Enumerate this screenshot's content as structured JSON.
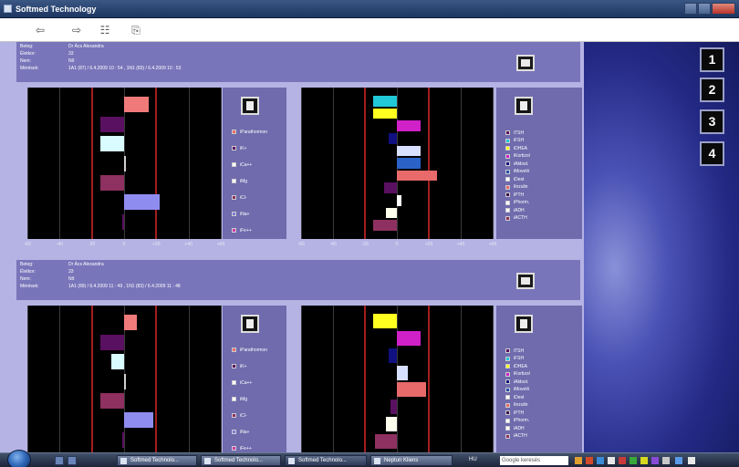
{
  "window": {
    "title": "Softmed Technology"
  },
  "toolbar": {
    "back_icon": "⇦",
    "forward_icon": "⇨",
    "note_icon": "☷",
    "copy_icon": "⎘"
  },
  "side_buttons": [
    "1",
    "2",
    "3",
    "4"
  ],
  "axis_ticks": [
    "-60",
    "-40",
    "-20",
    "0",
    "+20",
    "+40",
    "+60"
  ],
  "legend_left": [
    {
      "label": "iParathormon",
      "color": "#e86a6a"
    },
    {
      "label": "iK+",
      "color": "#5a1060"
    },
    {
      "label": "iCa++",
      "color": "#ffffff"
    },
    {
      "label": "iMg",
      "color": "#ffffff"
    },
    {
      "label": "iCl-",
      "color": "#8e3060"
    },
    {
      "label": "iNa+",
      "color": "#7b7bd8"
    },
    {
      "label": "iFe++",
      "color": "#d03aa8"
    }
  ],
  "legend_right": [
    {
      "label": "iTSH",
      "color": "#5a1060"
    },
    {
      "label": "iFSH",
      "color": "#20c8d8"
    },
    {
      "label": "iDHEA",
      "color": "#ffff20"
    },
    {
      "label": "iKortizol",
      "color": "#d020c8"
    },
    {
      "label": "iAldost.",
      "color": "#101080"
    },
    {
      "label": "iMovelö",
      "color": "#2050a8"
    },
    {
      "label": "iDest",
      "color": "#ffffff"
    },
    {
      "label": "iInzulin",
      "color": "#e86a6a"
    },
    {
      "label": "iPTH",
      "color": "#3a1050"
    },
    {
      "label": "iPhorm.",
      "color": "#ffffff"
    },
    {
      "label": "iADH",
      "color": "#ffffff"
    },
    {
      "label": "iACTH",
      "color": "#8e3060"
    }
  ],
  "records": [
    {
      "info": {
        "labels": [
          "Beteg:",
          "Életkor:",
          "Nem:",
          "Mérések:"
        ],
        "values": [
          "Dr Ács Alexandra",
          "33",
          "Nő",
          "1A1 (87) / 6.4.2009 10 : 54 , 1N1 (83) / 6.4.2009 10 : 53"
        ]
      },
      "chart_data": [
        {
          "type": "bar",
          "orientation": "horizontal",
          "xlim": [
            -60,
            60
          ],
          "reference_lines": [
            -20,
            20
          ],
          "bars": [
            {
              "start": 0,
              "end": 15,
              "color": "#f07a7a"
            },
            {
              "start": -15,
              "end": 0,
              "color": "#5a1060"
            },
            {
              "start": -15,
              "end": 0,
              "color": "#d8fcff"
            },
            {
              "start": 0,
              "end": 1,
              "color": "#cfcfcf"
            },
            {
              "start": -15,
              "end": 0,
              "color": "#8e3060"
            },
            {
              "start": 0,
              "end": 22,
              "color": "#8f8cf0"
            },
            {
              "start": -1,
              "end": 0,
              "color": "#5a1060"
            }
          ],
          "x_tick_labels": [
            "-60",
            "-40",
            "-20",
            "0",
            "+20",
            "+40",
            "+60"
          ]
        },
        {
          "type": "bar",
          "orientation": "horizontal",
          "xlim": [
            -60,
            60
          ],
          "reference_lines": [
            -20,
            20
          ],
          "bars": [
            {
              "start": -15,
              "end": 0,
              "color": "#20c8d8"
            },
            {
              "start": -15,
              "end": 0,
              "color": "#ffff20"
            },
            {
              "start": 0,
              "end": 15,
              "color": "#d020c8"
            },
            {
              "start": -5,
              "end": 0,
              "color": "#101080"
            },
            {
              "start": 0,
              "end": 15,
              "color": "#d8e0ff"
            },
            {
              "start": 0,
              "end": 15,
              "color": "#2a62c8"
            },
            {
              "start": 0,
              "end": 25,
              "color": "#e86a6a"
            },
            {
              "start": -8,
              "end": 0,
              "color": "#5a1060"
            },
            {
              "start": 0,
              "end": 3,
              "color": "#ffffff"
            },
            {
              "start": -7,
              "end": 0,
              "color": "#ffffee"
            },
            {
              "start": -15,
              "end": 0,
              "color": "#8e3060"
            }
          ],
          "x_tick_labels": [
            "-60",
            "-40",
            "-20",
            "0",
            "+20",
            "+40",
            "+60"
          ]
        }
      ]
    },
    {
      "info": {
        "labels": [
          "Beteg:",
          "Életkor:",
          "Nem:",
          "Mérések:"
        ],
        "values": [
          "Dr Ács Alexandra",
          "33",
          "Nő",
          "1A1 (89) / 6.4.2009 11 : 49 , 1N1 (83) / 6.4.2009 11 : 48"
        ]
      },
      "chart_data": [
        {
          "type": "bar",
          "orientation": "horizontal",
          "xlim": [
            -60,
            60
          ],
          "reference_lines": [
            -20,
            20
          ],
          "bars": [
            {
              "start": 0,
              "end": 8,
              "color": "#f07a7a"
            },
            {
              "start": -15,
              "end": 0,
              "color": "#5a1060"
            },
            {
              "start": -8,
              "end": 0,
              "color": "#d8fcff"
            },
            {
              "start": 0,
              "end": 1,
              "color": "#cfcfcf"
            },
            {
              "start": -15,
              "end": 0,
              "color": "#8e3060"
            },
            {
              "start": 0,
              "end": 18,
              "color": "#8f8cf0"
            },
            {
              "start": -1,
              "end": 0,
              "color": "#5a1060"
            }
          ],
          "x_tick_labels": []
        },
        {
          "type": "bar",
          "orientation": "horizontal",
          "xlim": [
            -60,
            60
          ],
          "reference_lines": [
            -20,
            20
          ],
          "bars": [
            {
              "start": -15,
              "end": 0,
              "color": "#ffff20"
            },
            {
              "start": 0,
              "end": 15,
              "color": "#d020c8"
            },
            {
              "start": -5,
              "end": 0,
              "color": "#101080"
            },
            {
              "start": 0,
              "end": 7,
              "color": "#d8e0ff"
            },
            {
              "start": 0,
              "end": 18,
              "color": "#e86a6a"
            },
            {
              "start": -4,
              "end": 0,
              "color": "#5a1060"
            },
            {
              "start": -7,
              "end": 0,
              "color": "#ffffee"
            },
            {
              "start": -14,
              "end": 0,
              "color": "#8e3060"
            }
          ],
          "x_tick_labels": []
        }
      ]
    }
  ],
  "taskbar": {
    "tasks": [
      "Softmed Technolo...",
      "Softmed Technolo...",
      "Softmed Technolo...",
      "Neptun Kliens"
    ],
    "language": "HU",
    "search_placeholder": "Google keresés"
  }
}
